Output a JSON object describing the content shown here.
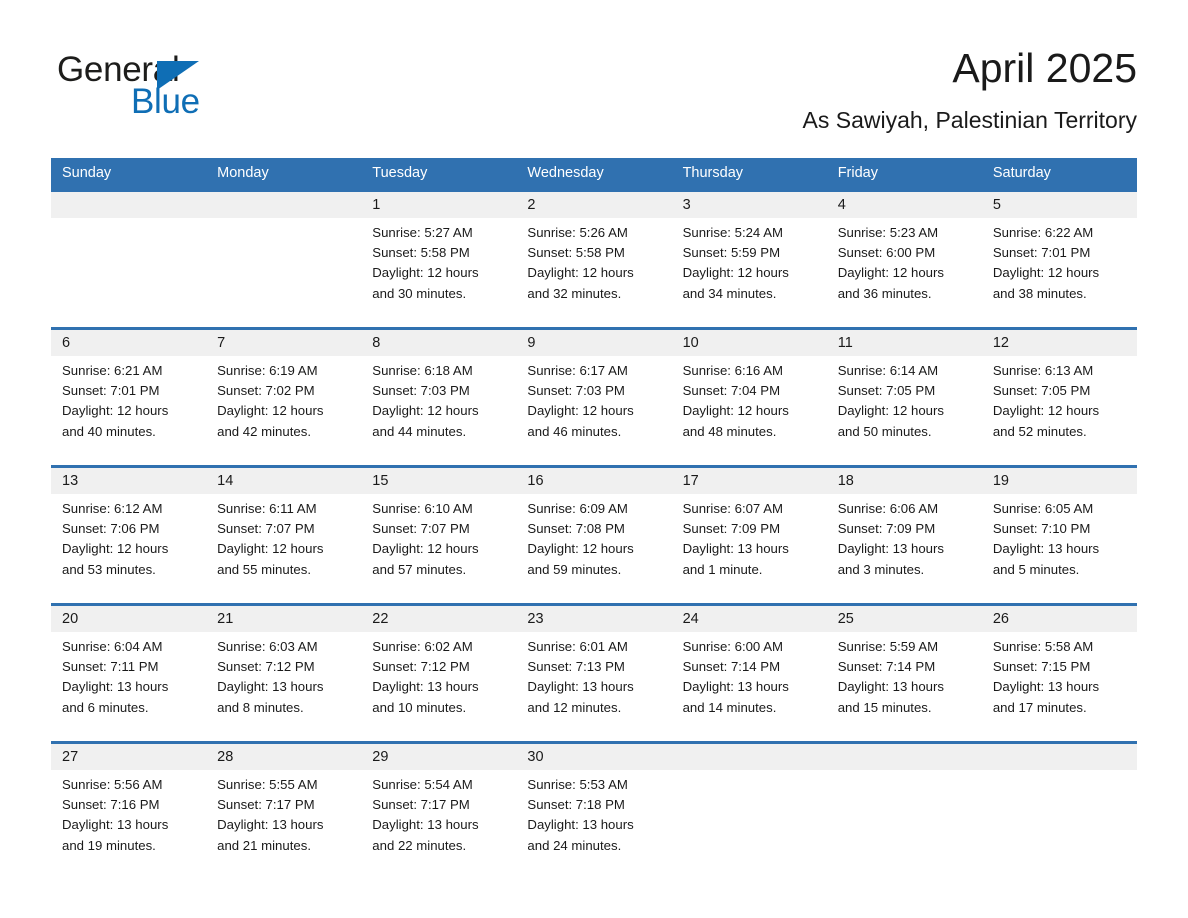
{
  "brand": {
    "name_part1": "General",
    "name_part2": "Blue",
    "triangle_color": "#0f6eb5",
    "text_color": "#1d1d1b"
  },
  "header": {
    "title": "April 2025",
    "subtitle": "As Sawiyah, Palestinian Territory"
  },
  "theme": {
    "accent": "#3071b0",
    "header_text": "#ffffff",
    "daynum_band": "#f0f0f0",
    "page_background": "#ffffff",
    "body_text": "#1a1a1a"
  },
  "weekday_headers": [
    "Sunday",
    "Monday",
    "Tuesday",
    "Wednesday",
    "Thursday",
    "Friday",
    "Saturday"
  ],
  "weeks": [
    [
      {
        "day": "",
        "sunrise": "",
        "sunset": "",
        "daylight1": "",
        "daylight2": ""
      },
      {
        "day": "",
        "sunrise": "",
        "sunset": "",
        "daylight1": "",
        "daylight2": ""
      },
      {
        "day": "1",
        "sunrise": "Sunrise: 5:27 AM",
        "sunset": "Sunset: 5:58 PM",
        "daylight1": "Daylight: 12 hours",
        "daylight2": "and 30 minutes."
      },
      {
        "day": "2",
        "sunrise": "Sunrise: 5:26 AM",
        "sunset": "Sunset: 5:58 PM",
        "daylight1": "Daylight: 12 hours",
        "daylight2": "and 32 minutes."
      },
      {
        "day": "3",
        "sunrise": "Sunrise: 5:24 AM",
        "sunset": "Sunset: 5:59 PM",
        "daylight1": "Daylight: 12 hours",
        "daylight2": "and 34 minutes."
      },
      {
        "day": "4",
        "sunrise": "Sunrise: 5:23 AM",
        "sunset": "Sunset: 6:00 PM",
        "daylight1": "Daylight: 12 hours",
        "daylight2": "and 36 minutes."
      },
      {
        "day": "5",
        "sunrise": "Sunrise: 6:22 AM",
        "sunset": "Sunset: 7:01 PM",
        "daylight1": "Daylight: 12 hours",
        "daylight2": "and 38 minutes."
      }
    ],
    [
      {
        "day": "6",
        "sunrise": "Sunrise: 6:21 AM",
        "sunset": "Sunset: 7:01 PM",
        "daylight1": "Daylight: 12 hours",
        "daylight2": "and 40 minutes."
      },
      {
        "day": "7",
        "sunrise": "Sunrise: 6:19 AM",
        "sunset": "Sunset: 7:02 PM",
        "daylight1": "Daylight: 12 hours",
        "daylight2": "and 42 minutes."
      },
      {
        "day": "8",
        "sunrise": "Sunrise: 6:18 AM",
        "sunset": "Sunset: 7:03 PM",
        "daylight1": "Daylight: 12 hours",
        "daylight2": "and 44 minutes."
      },
      {
        "day": "9",
        "sunrise": "Sunrise: 6:17 AM",
        "sunset": "Sunset: 7:03 PM",
        "daylight1": "Daylight: 12 hours",
        "daylight2": "and 46 minutes."
      },
      {
        "day": "10",
        "sunrise": "Sunrise: 6:16 AM",
        "sunset": "Sunset: 7:04 PM",
        "daylight1": "Daylight: 12 hours",
        "daylight2": "and 48 minutes."
      },
      {
        "day": "11",
        "sunrise": "Sunrise: 6:14 AM",
        "sunset": "Sunset: 7:05 PM",
        "daylight1": "Daylight: 12 hours",
        "daylight2": "and 50 minutes."
      },
      {
        "day": "12",
        "sunrise": "Sunrise: 6:13 AM",
        "sunset": "Sunset: 7:05 PM",
        "daylight1": "Daylight: 12 hours",
        "daylight2": "and 52 minutes."
      }
    ],
    [
      {
        "day": "13",
        "sunrise": "Sunrise: 6:12 AM",
        "sunset": "Sunset: 7:06 PM",
        "daylight1": "Daylight: 12 hours",
        "daylight2": "and 53 minutes."
      },
      {
        "day": "14",
        "sunrise": "Sunrise: 6:11 AM",
        "sunset": "Sunset: 7:07 PM",
        "daylight1": "Daylight: 12 hours",
        "daylight2": "and 55 minutes."
      },
      {
        "day": "15",
        "sunrise": "Sunrise: 6:10 AM",
        "sunset": "Sunset: 7:07 PM",
        "daylight1": "Daylight: 12 hours",
        "daylight2": "and 57 minutes."
      },
      {
        "day": "16",
        "sunrise": "Sunrise: 6:09 AM",
        "sunset": "Sunset: 7:08 PM",
        "daylight1": "Daylight: 12 hours",
        "daylight2": "and 59 minutes."
      },
      {
        "day": "17",
        "sunrise": "Sunrise: 6:07 AM",
        "sunset": "Sunset: 7:09 PM",
        "daylight1": "Daylight: 13 hours",
        "daylight2": "and 1 minute."
      },
      {
        "day": "18",
        "sunrise": "Sunrise: 6:06 AM",
        "sunset": "Sunset: 7:09 PM",
        "daylight1": "Daylight: 13 hours",
        "daylight2": "and 3 minutes."
      },
      {
        "day": "19",
        "sunrise": "Sunrise: 6:05 AM",
        "sunset": "Sunset: 7:10 PM",
        "daylight1": "Daylight: 13 hours",
        "daylight2": "and 5 minutes."
      }
    ],
    [
      {
        "day": "20",
        "sunrise": "Sunrise: 6:04 AM",
        "sunset": "Sunset: 7:11 PM",
        "daylight1": "Daylight: 13 hours",
        "daylight2": "and 6 minutes."
      },
      {
        "day": "21",
        "sunrise": "Sunrise: 6:03 AM",
        "sunset": "Sunset: 7:12 PM",
        "daylight1": "Daylight: 13 hours",
        "daylight2": "and 8 minutes."
      },
      {
        "day": "22",
        "sunrise": "Sunrise: 6:02 AM",
        "sunset": "Sunset: 7:12 PM",
        "daylight1": "Daylight: 13 hours",
        "daylight2": "and 10 minutes."
      },
      {
        "day": "23",
        "sunrise": "Sunrise: 6:01 AM",
        "sunset": "Sunset: 7:13 PM",
        "daylight1": "Daylight: 13 hours",
        "daylight2": "and 12 minutes."
      },
      {
        "day": "24",
        "sunrise": "Sunrise: 6:00 AM",
        "sunset": "Sunset: 7:14 PM",
        "daylight1": "Daylight: 13 hours",
        "daylight2": "and 14 minutes."
      },
      {
        "day": "25",
        "sunrise": "Sunrise: 5:59 AM",
        "sunset": "Sunset: 7:14 PM",
        "daylight1": "Daylight: 13 hours",
        "daylight2": "and 15 minutes."
      },
      {
        "day": "26",
        "sunrise": "Sunrise: 5:58 AM",
        "sunset": "Sunset: 7:15 PM",
        "daylight1": "Daylight: 13 hours",
        "daylight2": "and 17 minutes."
      }
    ],
    [
      {
        "day": "27",
        "sunrise": "Sunrise: 5:56 AM",
        "sunset": "Sunset: 7:16 PM",
        "daylight1": "Daylight: 13 hours",
        "daylight2": "and 19 minutes."
      },
      {
        "day": "28",
        "sunrise": "Sunrise: 5:55 AM",
        "sunset": "Sunset: 7:17 PM",
        "daylight1": "Daylight: 13 hours",
        "daylight2": "and 21 minutes."
      },
      {
        "day": "29",
        "sunrise": "Sunrise: 5:54 AM",
        "sunset": "Sunset: 7:17 PM",
        "daylight1": "Daylight: 13 hours",
        "daylight2": "and 22 minutes."
      },
      {
        "day": "30",
        "sunrise": "Sunrise: 5:53 AM",
        "sunset": "Sunset: 7:18 PM",
        "daylight1": "Daylight: 13 hours",
        "daylight2": "and 24 minutes."
      },
      {
        "day": "",
        "sunrise": "",
        "sunset": "",
        "daylight1": "",
        "daylight2": ""
      },
      {
        "day": "",
        "sunrise": "",
        "sunset": "",
        "daylight1": "",
        "daylight2": ""
      },
      {
        "day": "",
        "sunrise": "",
        "sunset": "",
        "daylight1": "",
        "daylight2": ""
      }
    ]
  ]
}
